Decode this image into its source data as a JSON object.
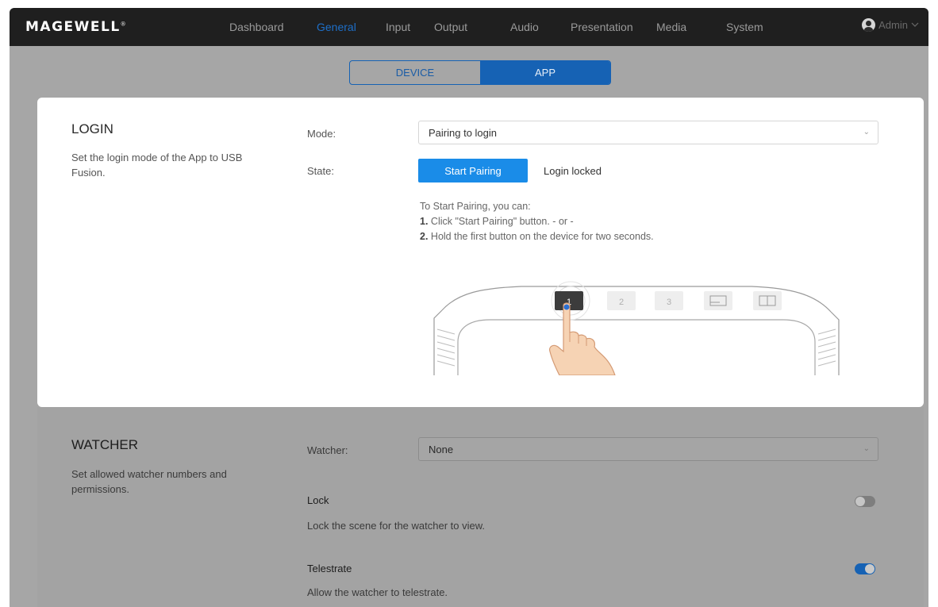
{
  "header": {
    "logo_text": "MAGEWELL",
    "logo_mark": "®",
    "nav": [
      "Dashboard",
      "General",
      "Input",
      "Output",
      "Audio",
      "Presentation",
      "Media",
      "System"
    ],
    "active_nav": "General",
    "user_label": "Admin",
    "user_icon": "user-avatar-icon",
    "user_chevron": "chevron-down-icon"
  },
  "tabs": {
    "device_label": "DEVICE",
    "app_label": "APP",
    "selected": "APP"
  },
  "login": {
    "title": "LOGIN",
    "description": "Set the login mode of the App to USB Fusion.",
    "mode_label": "Mode:",
    "mode_value": "Pairing to login",
    "state_label": "State:",
    "start_pairing_label": "Start Pairing",
    "state_status": "Login locked",
    "instructions_intro": "To Start Pairing, you can:",
    "step1_num": "1.",
    "step1_text": "Click \"Start Pairing\" button. - or -",
    "step2_num": "2.",
    "step2_text": "Hold the first button on the device for two seconds.",
    "device_buttons": [
      "1",
      "2",
      "3"
    ]
  },
  "watcher": {
    "title": "WATCHER",
    "description": "Set allowed watcher numbers and permissions.",
    "watcher_label": "Watcher:",
    "watcher_value": "None",
    "lock_title": "Lock",
    "lock_desc": "Lock the scene for the watcher to view.",
    "lock_enabled": false,
    "telestrate_title": "Telestrate",
    "telestrate_desc": "Allow the watcher to telestrate.",
    "telestrate_enabled": true
  },
  "colors": {
    "accent": "#1a8ce8",
    "nav_active": "#1e6fc8",
    "topbar": "#1f1f1f",
    "overlay": "#a6a6a6"
  }
}
